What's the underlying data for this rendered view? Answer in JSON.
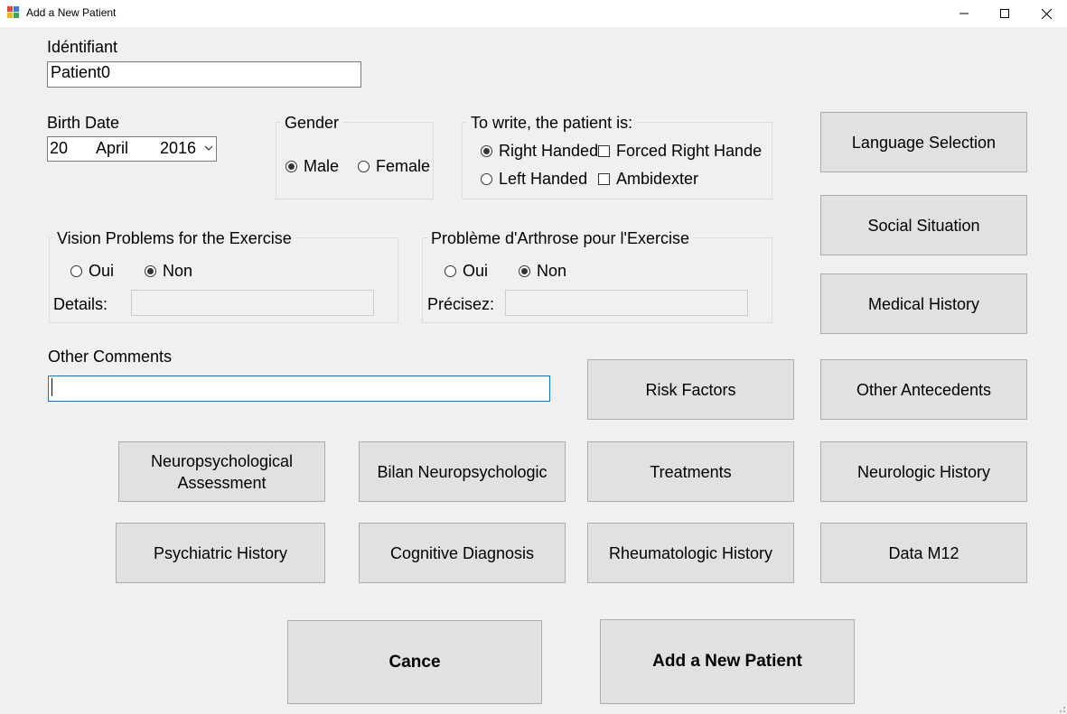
{
  "window": {
    "title": "Add a New Patient"
  },
  "identifier": {
    "label": "Idéntifiant",
    "value": "Patient0"
  },
  "birth_date": {
    "label": "Birth Date",
    "day": "20",
    "month": "April",
    "year": "2016"
  },
  "gender": {
    "title": "Gender",
    "male": "Male",
    "female": "Female",
    "selected": "Male"
  },
  "handedness": {
    "title": "To write, the patient is:",
    "right": "Right Handed",
    "left": "Left Handed",
    "forced_right": "Forced Right Hande",
    "ambidexter": "Ambidexter",
    "selected": "Right Handed"
  },
  "vision": {
    "title": "Vision Problems for the Exercise",
    "oui": "Oui",
    "non": "Non",
    "selected": "Non",
    "details_label": "Details:",
    "details_value": ""
  },
  "arthrose": {
    "title": "Problème d'Arthrose pour l'Exercise",
    "oui": "Oui",
    "non": "Non",
    "selected": "Non",
    "details_label": "Précisez:",
    "details_value": ""
  },
  "comments": {
    "label": "Other Comments",
    "value": ""
  },
  "buttons": {
    "language_selection": "Language Selection",
    "social_situation": "Social Situation",
    "medical_history": "Medical History",
    "risk_factors": "Risk Factors",
    "other_antecedents": "Other Antecedents",
    "neuropsychological_assessment": "Neuropsychological Assessment",
    "bilan_neuropsychologic": "Bilan Neuropsychologic",
    "treatments": "Treatments",
    "neurologic_history": "Neurologic History",
    "psychiatric_history": "Psychiatric History",
    "cognitive_diagnosis": "Cognitive Diagnosis",
    "rheumatologic_history": "Rheumatologic History",
    "data_m12": "Data M12",
    "cancel": "Cance",
    "add_patient": "Add a New Patient"
  },
  "icons": [
    "app-icon",
    "minimize-icon",
    "maximize-icon",
    "close-icon",
    "chevron-down-icon",
    "resize-grip-icon"
  ]
}
